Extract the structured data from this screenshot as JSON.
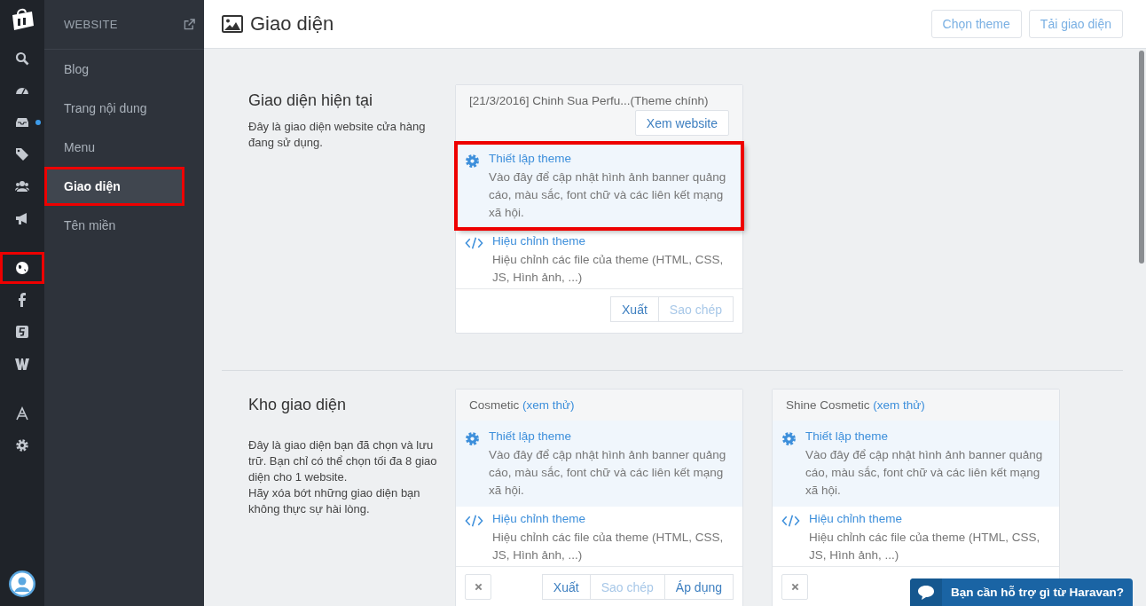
{
  "rail": {
    "groups": [
      [
        {
          "highlighted": false,
          "unread": false
        },
        {
          "highlighted": false,
          "unread": false
        },
        {
          "highlighted": false,
          "unread": true
        },
        {
          "highlighted": false,
          "unread": false
        },
        {
          "highlighted": false,
          "unread": false
        },
        {
          "highlighted": false,
          "unread": false
        }
      ],
      [
        {
          "highlighted": true,
          "unread": false
        },
        {
          "highlighted": false,
          "unread": false
        },
        {
          "highlighted": false,
          "unread": false
        },
        {
          "highlighted": false,
          "unread": false
        }
      ],
      [
        {
          "highlighted": false,
          "unread": false
        },
        {
          "highlighted": false,
          "unread": false
        }
      ]
    ]
  },
  "subnav": {
    "title": "WEBSITE",
    "items": [
      {
        "label": "Blog",
        "selected": false,
        "highlighted": false
      },
      {
        "label": "Trang nội dung",
        "selected": false,
        "highlighted": false
      },
      {
        "label": "Menu",
        "selected": false,
        "highlighted": false
      },
      {
        "label": "Giao diện",
        "selected": true,
        "highlighted": true
      },
      {
        "label": "Tên miền",
        "selected": false,
        "highlighted": false
      }
    ]
  },
  "header": {
    "title": "Giao diện",
    "buttons": [
      "Chọn theme",
      "Tải giao diện"
    ]
  },
  "sections": [
    {
      "title": "Giao diện hiện tại",
      "paragraphs": [
        "Đây là giao diện website cửa hàng đang sử dụng."
      ],
      "cards": [
        {
          "kind": "current",
          "name": "[21/3/2016] Chinh Sua Perfu...(Theme chính)",
          "view_button": "Xem website",
          "options": [
            {
              "kind": "settings",
              "title": "Thiết lập theme",
              "description": "Vào đây để cập nhật hình ảnh banner quảng cáo, màu sắc, font chữ và các liên kết mạng xã hội.",
              "highlighted": true
            },
            {
              "kind": "code",
              "title": "Hiệu chỉnh theme",
              "description": "Hiệu chỉnh các file của theme (HTML, CSS, JS, Hình ảnh, ...)",
              "highlighted": false
            }
          ],
          "buttons": [
            {
              "label": "Xuất",
              "disabled": false
            },
            {
              "label": "Sao chép",
              "disabled": true
            }
          ]
        }
      ]
    },
    {
      "title": "Kho giao diện",
      "paragraphs": [
        "Đây là giao diện bạn đã chọn và lưu trữ. Bạn chỉ có thể chọn tối đa 8 giao diện cho 1 website.",
        "Hãy xóa bớt những giao diện bạn không thực sự hài lòng."
      ],
      "cards": [
        {
          "kind": "library",
          "name": "Cosmetic",
          "preview_link": "(xem thử)",
          "options": [
            {
              "kind": "settings",
              "title": "Thiết lập theme",
              "description": "Vào đây để cập nhật hình ảnh banner quảng cáo, màu sắc, font chữ và các liên kết mạng xã hội.",
              "highlighted": false
            },
            {
              "kind": "code",
              "title": "Hiệu chỉnh theme",
              "description": "Hiệu chỉnh các file của theme (HTML, CSS, JS, Hình ảnh, ...)",
              "highlighted": false
            }
          ],
          "buttons": [
            {
              "label": "Xuất",
              "disabled": false
            },
            {
              "label": "Sao chép",
              "disabled": true
            },
            {
              "label": "Áp dụng",
              "disabled": false
            }
          ]
        },
        {
          "kind": "library",
          "name": "Shine Cosmetic",
          "preview_link": "(xem thử)",
          "options": [
            {
              "kind": "settings",
              "title": "Thiết lập theme",
              "description": "Vào đây để cập nhật hình ảnh banner quảng cáo, màu sắc, font chữ và các liên kết mạng xã hội.",
              "highlighted": false
            },
            {
              "kind": "code",
              "title": "Hiệu chỉnh theme",
              "description": "Hiệu chỉnh các file của theme (HTML, CSS, JS, Hình ảnh, ...)",
              "highlighted": false
            }
          ]
        }
      ]
    }
  ],
  "chat": {
    "label": "Bạn cần hỗ trợ gì từ Haravan?"
  }
}
